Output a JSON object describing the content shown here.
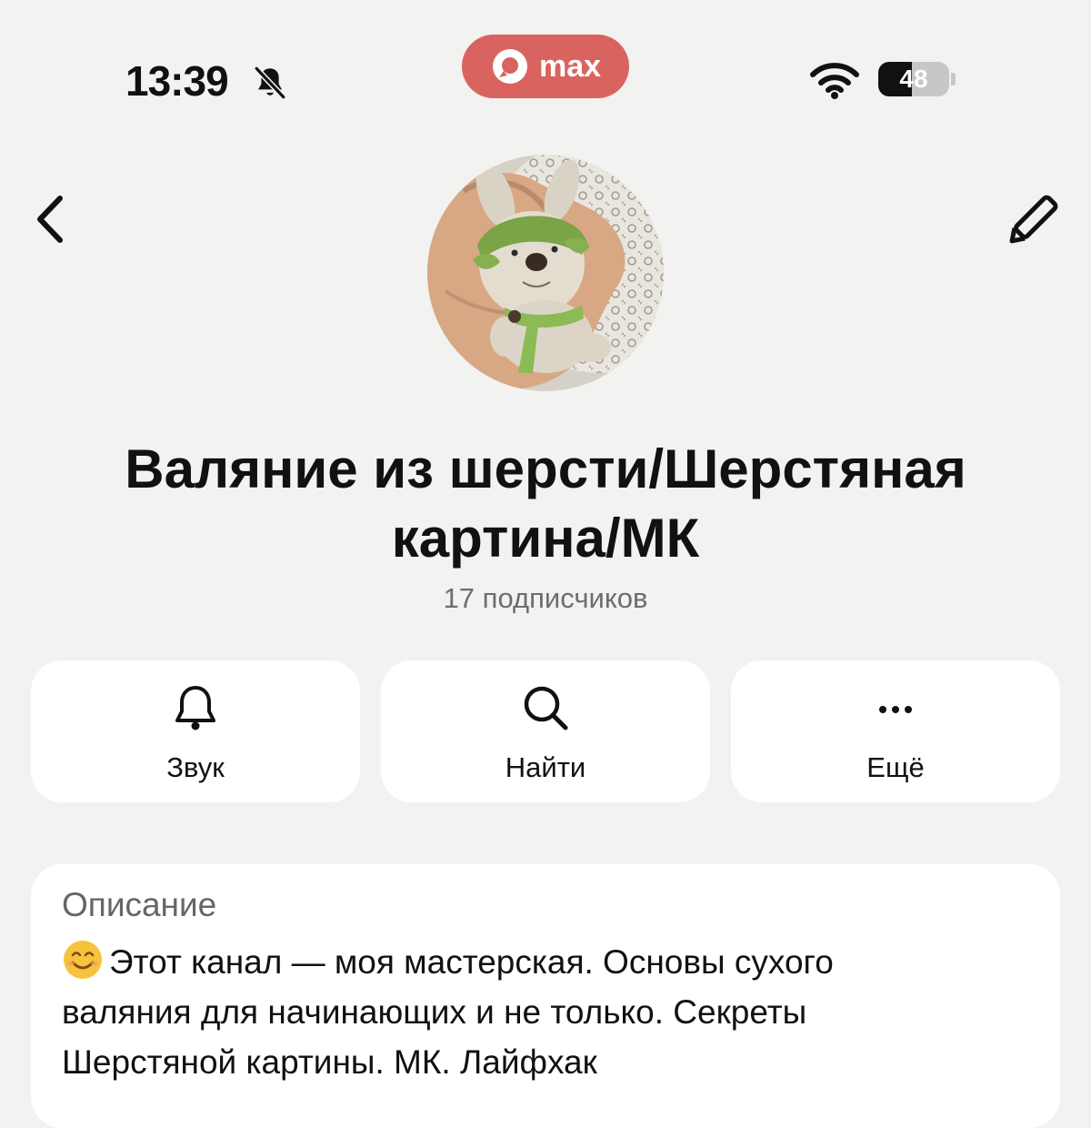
{
  "status_bar": {
    "time": "13:39",
    "battery_level": "48",
    "battery_fraction": 0.48,
    "mute_icon": "bell-slash-icon",
    "wifi_icon": "wifi-icon"
  },
  "app_pill": {
    "label": "max",
    "color": "#d9645f"
  },
  "nav": {
    "back_icon": "chevron-left-icon",
    "edit_icon": "pencil-icon"
  },
  "channel": {
    "title": "Валяние из шерсти/Шерстяная картина/МК",
    "subscribers": "17 подписчиков"
  },
  "actions": [
    {
      "label": "Звук",
      "icon": "bell-icon"
    },
    {
      "label": "Найти",
      "icon": "search-icon"
    },
    {
      "label": "Ещё",
      "icon": "more-dots-icon"
    }
  ],
  "description": {
    "header": "Описание",
    "text": "Этот канал — моя мастерская. Основы сухого валяния для начинающих и не только. Секреты Шерстяной картины. МК. Лайфхак"
  }
}
